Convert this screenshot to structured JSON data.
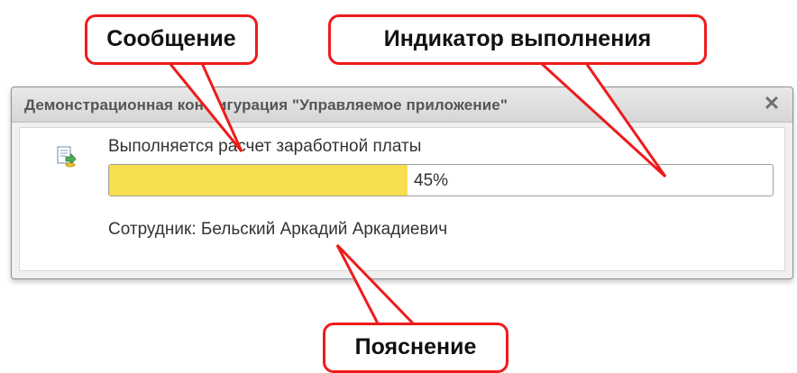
{
  "dialog": {
    "title": "Демонстрационная конфигурация \"Управляемое приложение\"",
    "close_glyph": "✕",
    "message": "Выполняется расчет заработной платы",
    "progress": {
      "percent": 45,
      "label": "45%"
    },
    "explanation": "Сотрудник: Бельский Аркадий Аркадиевич",
    "icon": "calculation-document-icon"
  },
  "callouts": {
    "message": "Сообщение",
    "indicator": "Индикатор выполнения",
    "explanation": "Пояснение"
  },
  "colors": {
    "callout_border": "#ee1b1b",
    "progress_fill": "#f7de4f"
  }
}
